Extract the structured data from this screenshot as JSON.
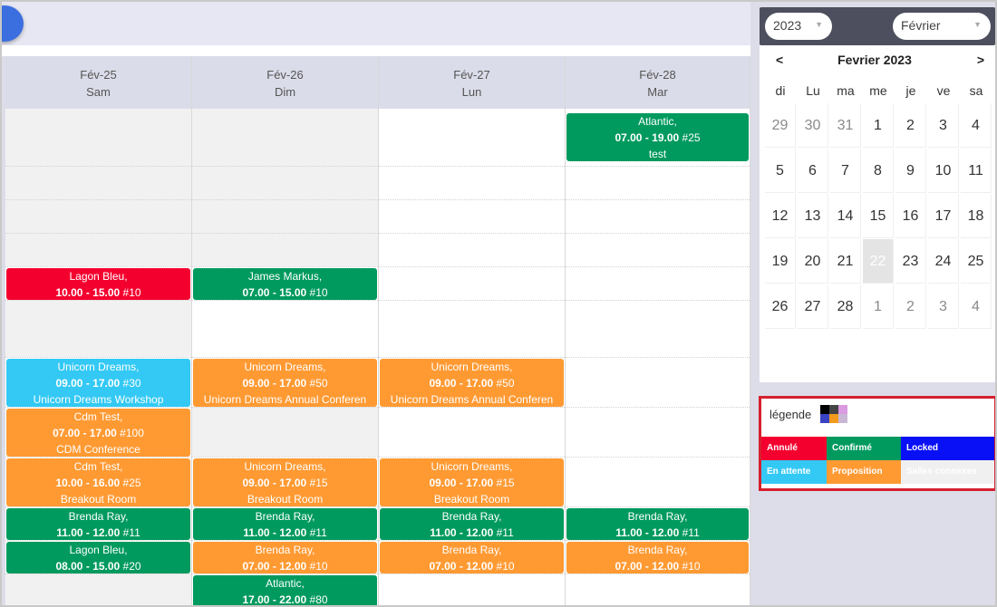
{
  "days": [
    {
      "date": "Fév-25",
      "weekday": "Sam",
      "events": [
        {
          "color": "red",
          "title": "Lagon Bleu,",
          "time": "10.00 - 15.00",
          "num": "#10",
          "sub": ""
        },
        {
          "color": "cyan",
          "title": "Unicorn Dreams,",
          "time": "09.00 - 17.00",
          "num": "#30",
          "sub": "Unicorn Dreams Workshop"
        },
        {
          "color": "orange",
          "title": "Cdm Test,",
          "time": "07.00 - 17.00",
          "num": "#100",
          "sub": "CDM Conference"
        },
        {
          "color": "orange",
          "title": "Cdm Test,",
          "time": "10.00 - 16.00",
          "num": "#25",
          "sub": "Breakout Room"
        },
        {
          "color": "green",
          "title": "Brenda Ray,",
          "time": "11.00 - 12.00",
          "num": "#11",
          "sub": ""
        },
        {
          "color": "green",
          "title": "Lagon Bleu,",
          "time": "08.00 - 15.00",
          "num": "#20",
          "sub": ""
        }
      ]
    },
    {
      "date": "Fév-26",
      "weekday": "Dim",
      "events": [
        {
          "color": "green",
          "title": "James Markus,",
          "time": "07.00 - 15.00",
          "num": "#10",
          "sub": ""
        },
        {
          "color": "orange",
          "title": "Unicorn Dreams,",
          "time": "09.00 - 17.00",
          "num": "#50",
          "sub": "Unicorn Dreams Annual Conferen"
        },
        {
          "color": "orange",
          "title": "Unicorn Dreams,",
          "time": "09.00 - 17.00",
          "num": "#15",
          "sub": "Breakout Room"
        },
        {
          "color": "green",
          "title": "Brenda Ray,",
          "time": "11.00 - 12.00",
          "num": "#11",
          "sub": ""
        },
        {
          "color": "orange",
          "title": "Brenda Ray,",
          "time": "07.00 - 12.00",
          "num": "#10",
          "sub": ""
        },
        {
          "color": "green",
          "title": "Atlantic,",
          "time": "17.00 - 22.00",
          "num": "#80",
          "sub": ""
        }
      ]
    },
    {
      "date": "Fév-27",
      "weekday": "Lun",
      "events": [
        {
          "color": "orange",
          "title": "Unicorn Dreams,",
          "time": "09.00 - 17.00",
          "num": "#50",
          "sub": "Unicorn Dreams Annual Conferen"
        },
        {
          "color": "orange",
          "title": "Unicorn Dreams,",
          "time": "09.00 - 17.00",
          "num": "#15",
          "sub": "Breakout Room"
        },
        {
          "color": "green",
          "title": "Brenda Ray,",
          "time": "11.00 - 12.00",
          "num": "#11",
          "sub": ""
        },
        {
          "color": "orange",
          "title": "Brenda Ray,",
          "time": "07.00 - 12.00",
          "num": "#10",
          "sub": ""
        }
      ]
    },
    {
      "date": "Fév-28",
      "weekday": "Mar",
      "events": [
        {
          "color": "green",
          "title": "Atlantic,",
          "time": "07.00 - 19.00",
          "num": "#25",
          "sub": "test"
        },
        {
          "color": "green",
          "title": "Brenda Ray,",
          "time": "11.00 - 12.00",
          "num": "#11",
          "sub": ""
        },
        {
          "color": "orange",
          "title": "Brenda Ray,",
          "time": "07.00 - 12.00",
          "num": "#10",
          "sub": ""
        }
      ]
    }
  ],
  "selectors": {
    "year": "2023",
    "month": "Février"
  },
  "minical": {
    "prev": "<",
    "next": ">",
    "title": "Fevrier 2023",
    "dow": [
      "di",
      "Lu",
      "ma",
      "me",
      "je",
      "ve",
      "sa"
    ],
    "weeks": [
      [
        "29",
        "30",
        "31",
        "1",
        "2",
        "3",
        "4"
      ],
      [
        "5",
        "6",
        "7",
        "8",
        "9",
        "10",
        "11"
      ],
      [
        "12",
        "13",
        "14",
        "15",
        "16",
        "17",
        "18"
      ],
      [
        "19",
        "20",
        "21",
        "22",
        "23",
        "24",
        "25"
      ],
      [
        "26",
        "27",
        "28",
        "1",
        "2",
        "3",
        "4"
      ]
    ],
    "selected": "22"
  },
  "legend": {
    "title": "légende",
    "items": [
      {
        "label": "Annulé",
        "color": "#f4002e"
      },
      {
        "label": "Confirmé",
        "color": "#009a5e"
      },
      {
        "label": "Locked",
        "color": "#0a10f5"
      },
      {
        "label": "En attente",
        "color": "#33c9f4"
      },
      {
        "label": "Proposition",
        "color": "#ff9a33"
      },
      {
        "label": "Salles connexes",
        "color": "#f0f0f0"
      }
    ]
  }
}
